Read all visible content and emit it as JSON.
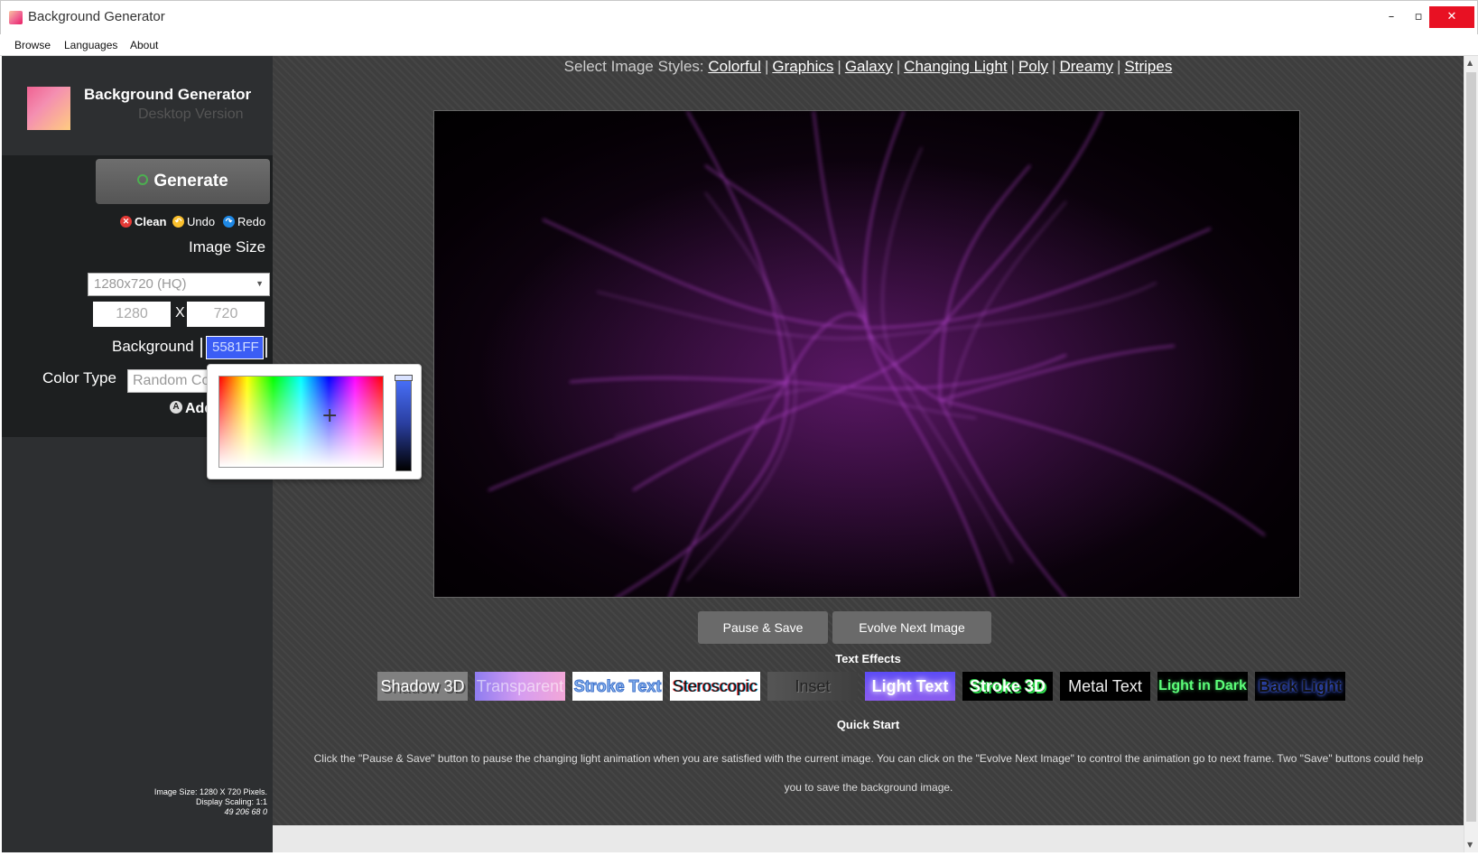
{
  "window": {
    "title": "Background Generator",
    "controls": {
      "minimize": "–",
      "maximize": "▫",
      "close": "✕"
    }
  },
  "menu": [
    "Browse",
    "Languages",
    "About"
  ],
  "sidebar": {
    "brand_title": "Background Generator",
    "brand_subtitle": "Desktop Version",
    "generate_label": "Generate",
    "actions": {
      "clean": "Clean",
      "undo": "Undo",
      "redo": "Redo"
    },
    "image_size_label": "Image Size",
    "size_preset": "1280x720 (HQ)",
    "width": "1280",
    "height": "720",
    "x_separator": "X",
    "background_label": "Background",
    "background_value": "5581FF",
    "color_type_label": "Color Type",
    "color_type_value": "Random Color",
    "add_label": "Add",
    "info_line1": "Image Size: 1280 X 720 Pixels.",
    "info_line2": "Display Scaling: 1:1",
    "info_line3": "49 206 68 0"
  },
  "styles": {
    "prefix": "Select Image Styles:",
    "items": [
      "Colorful",
      "Graphics",
      "Galaxy",
      "Changing Light",
      "Poly",
      "Dreamy",
      "Stripes"
    ],
    "separator": "|"
  },
  "controls": {
    "pause_save": "Pause & Save",
    "evolve_next": "Evolve Next Image"
  },
  "text_effects": {
    "title": "Text Effects",
    "items": [
      "Shadow 3D",
      "Transparent",
      "Stroke Text",
      "Steroscopic",
      "Inset",
      "Light Text",
      "Stroke 3D",
      "Metal Text",
      "Light in Dark",
      "Back Light"
    ]
  },
  "quick_start": {
    "title": "Quick Start",
    "text": "Click the \"Pause & Save\" button to pause the changing light animation when you are satisfied with the current image. You can click on the \"Evolve Next Image\" to control the animation go to next frame. Two \"Save\" buttons could help you to save the background image."
  },
  "colors": {
    "accent": "#3b5df5",
    "preview_glow": "#c040e0",
    "close_button": "#e81123"
  }
}
